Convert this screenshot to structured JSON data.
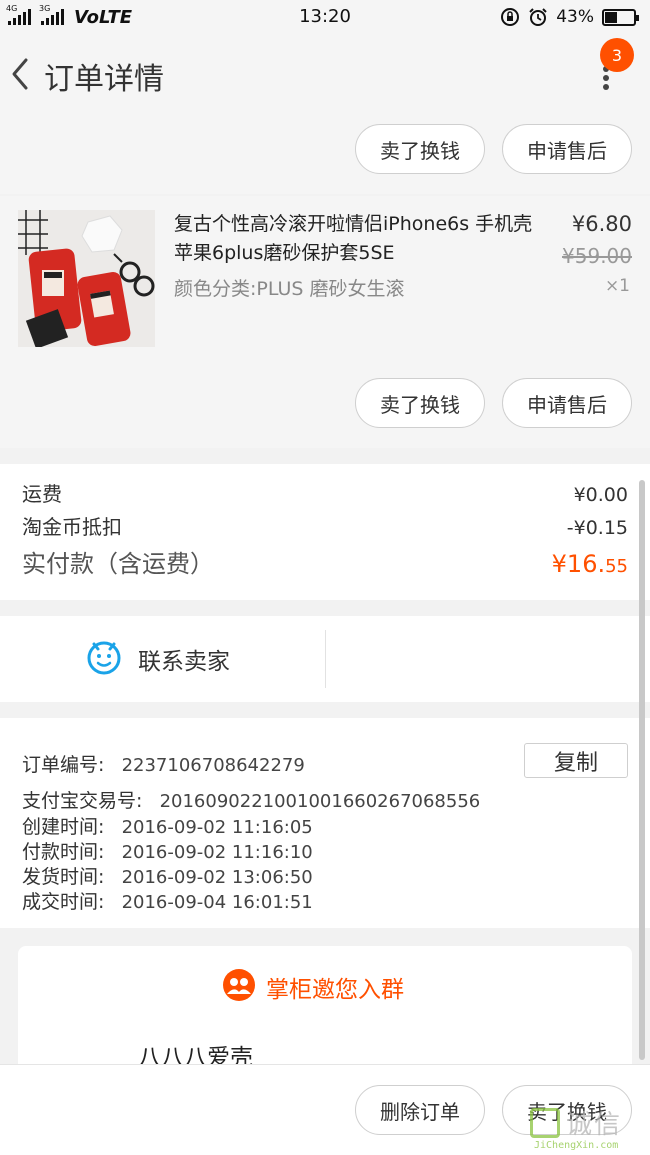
{
  "status_bar": {
    "signal_1_tag": "4G",
    "signal_2_tag": "3G",
    "network": "VoLTE",
    "time": "13:20",
    "battery": "43%",
    "battery_level": 0.43
  },
  "header": {
    "title": "订单详情",
    "notification_count": "3"
  },
  "top_actions": {
    "sell_label": "卖了换钱",
    "after_sale_label": "申请售后"
  },
  "product": {
    "title": "复古个性高冷滚开啦情侣iPhone6s 手机壳 苹果6plus磨砂保护套5SE",
    "spec": "颜色分类:PLUS 磨砂女生滚",
    "price": "¥6.80",
    "original_price": "¥59.00",
    "quantity": "×1",
    "sell_label": "卖了换钱",
    "after_sale_label": "申请售后"
  },
  "costs": {
    "shipping_label": "运费",
    "shipping_value": "¥0.00",
    "coin_label": "淘金币抵扣",
    "coin_value": "-¥0.15",
    "total_label": "实付款（含运费）",
    "total_value_main": "¥16.",
    "total_value_cents": "55"
  },
  "contact": {
    "label": "联系卖家"
  },
  "order_info": {
    "order_no_label": "订单编号:",
    "order_no": "2237106708642279",
    "copy_label": "复制",
    "alipay_label": "支付宝交易号:",
    "alipay_no": "2016090221001001660267068556",
    "created_label": "创建时间:",
    "created": "2016-09-02 11:16:05",
    "paid_label": "付款时间:",
    "paid": "2016-09-02 11:16:10",
    "shipped_label": "发货时间:",
    "shipped": "2016-09-02 13:06:50",
    "completed_label": "成交时间:",
    "completed": "2016-09-04 16:01:51"
  },
  "group": {
    "title": "掌柜邀您入群",
    "name": "八八八爱壳"
  },
  "bottom_bar": {
    "delete_label": "删除订单",
    "sell_label": "卖了换钱"
  },
  "watermark": {
    "text": "诚信",
    "sub": "JiChengXin.com"
  },
  "colors": {
    "accent": "#ff5000",
    "background": "#f2f2f2"
  }
}
